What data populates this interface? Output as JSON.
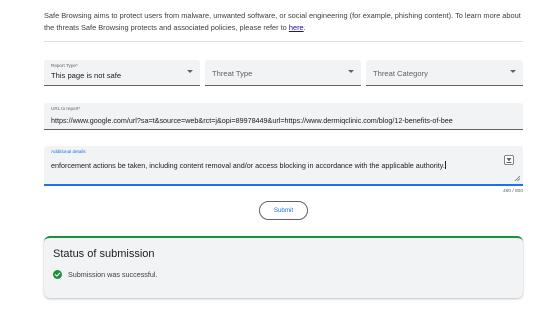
{
  "intro": {
    "text": "Safe Browsing aims to protect users from malware, unwanted software, or social engineering (for example, phishing content). To learn more about the threats Safe Browsing protects and associated policies, please refer to ",
    "link": "here",
    "end": "."
  },
  "form": {
    "report_type": {
      "label": "Report Type*",
      "value": "This page is not safe"
    },
    "threat_type": {
      "placeholder": "Threat Type"
    },
    "threat_category": {
      "placeholder": "Threat Category"
    },
    "url": {
      "label": "URL to report*",
      "value": "https://www.google.com/url?sa=t&source=web&rct=j&opi=89978449&url=https://www.dermiqclinic.com/blog/12-benefits-of-bee"
    },
    "details": {
      "label": "Additional details",
      "value": "enforcement actions be taken, including content removal and/or access blocking in accordance with the applicable authority."
    },
    "counter": "480 / 800",
    "submit_label": "Submit"
  },
  "status": {
    "title": "Status of submission",
    "message": "Submission was successful.",
    "accent_color": "#1e8e3e"
  }
}
